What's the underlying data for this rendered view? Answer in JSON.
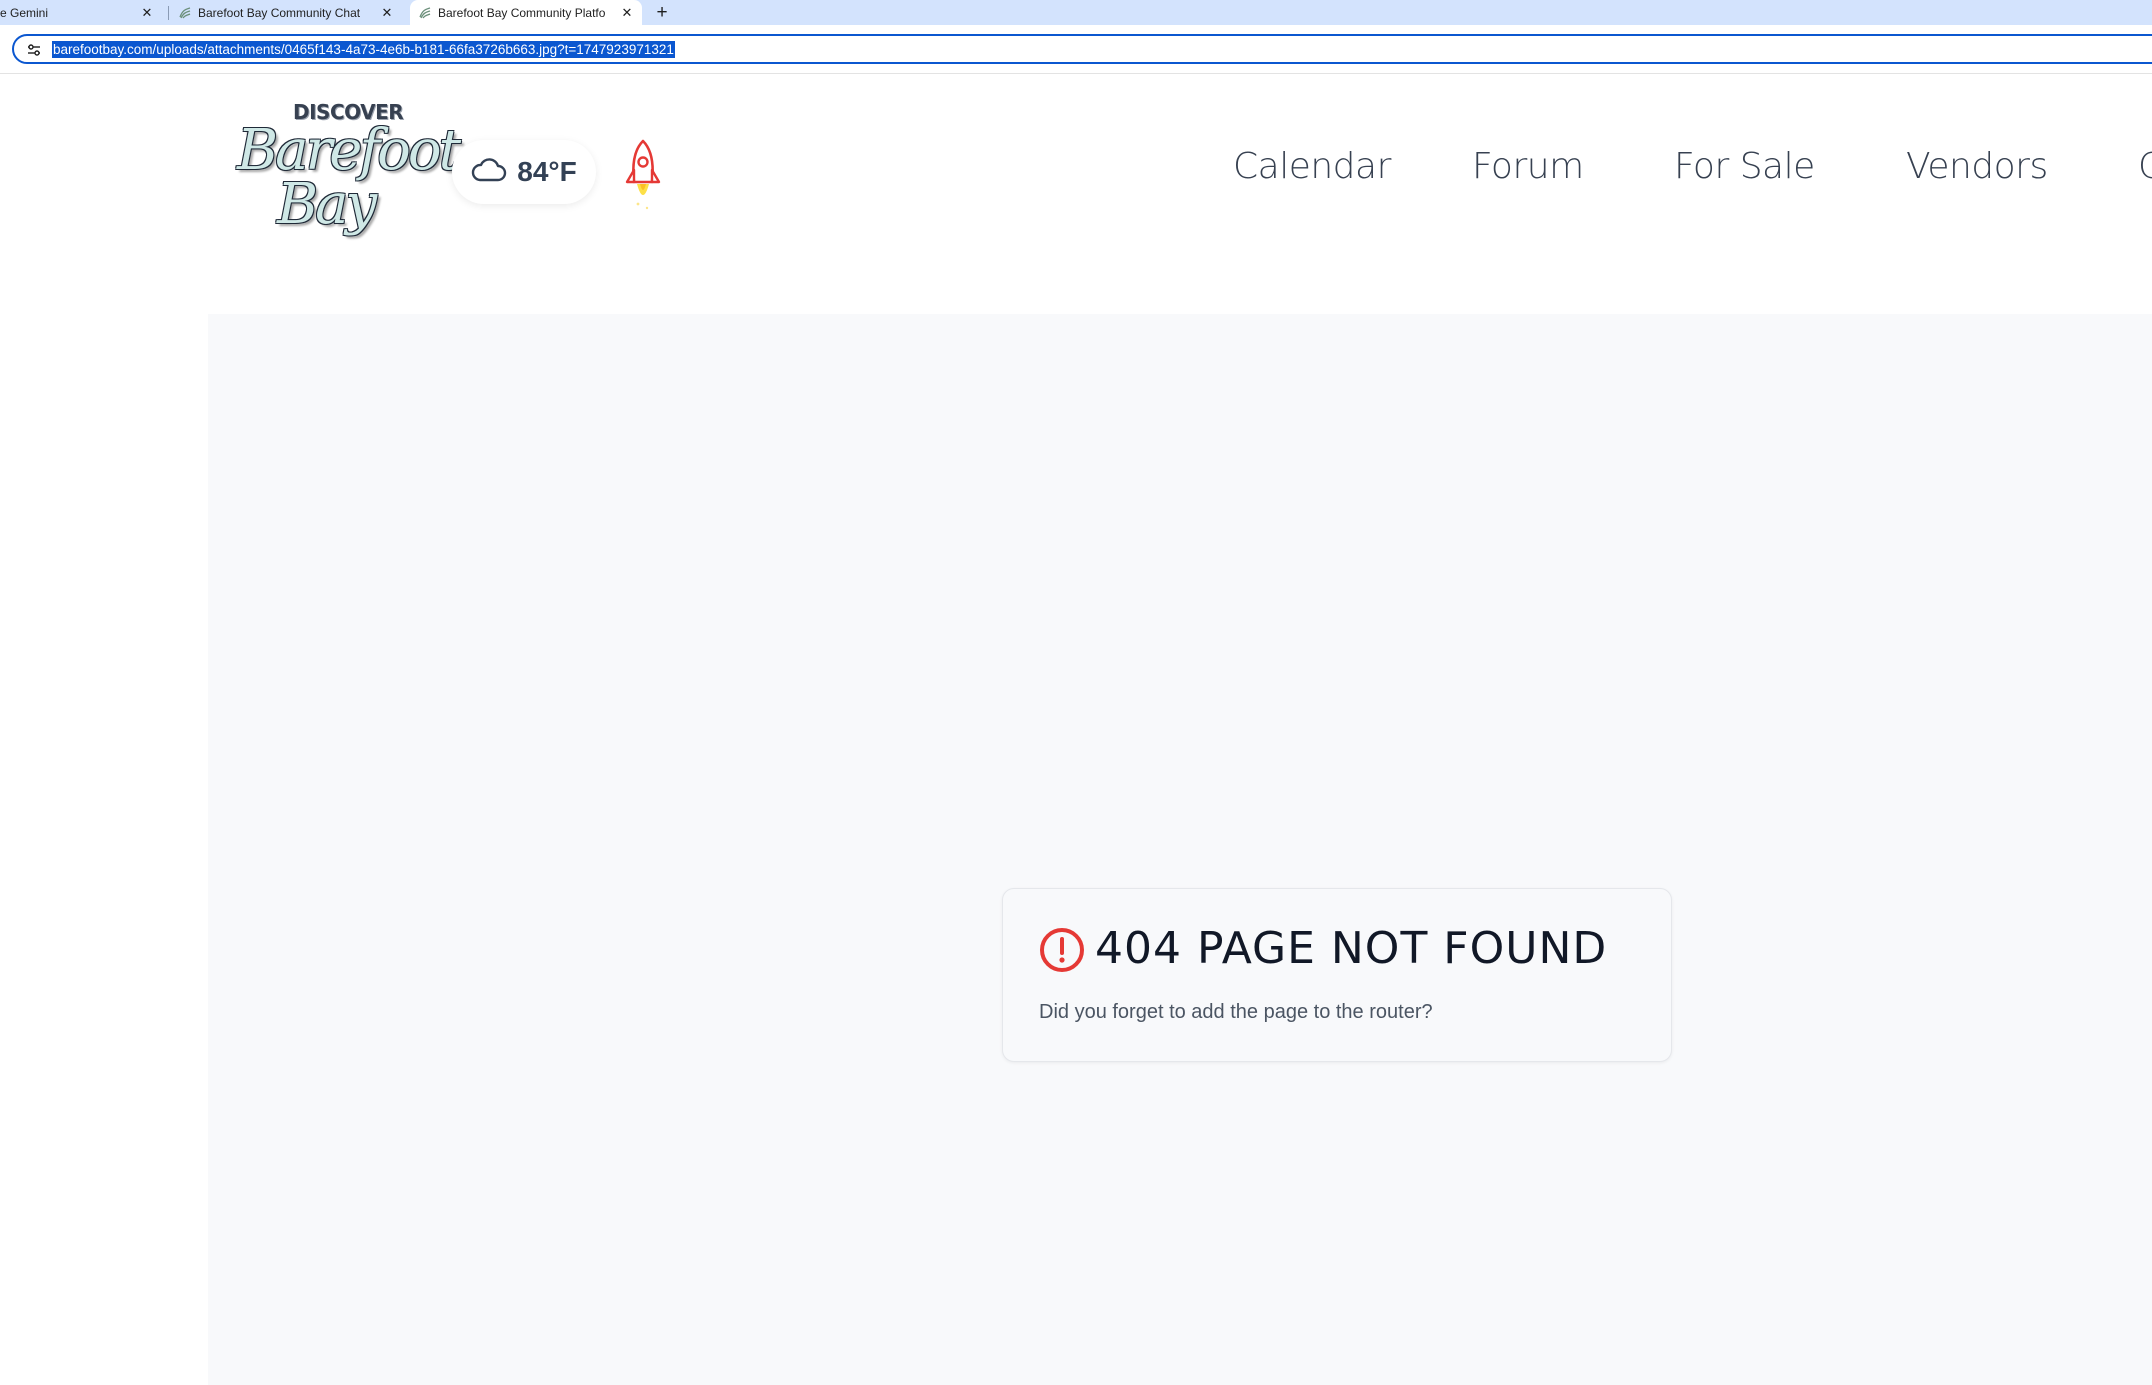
{
  "browser": {
    "tabs": [
      {
        "title": "e Gemini",
        "active": false
      },
      {
        "title": "Barefoot Bay Community Chat",
        "active": false
      },
      {
        "title": "Barefoot Bay Community Platfo",
        "active": true
      }
    ],
    "new_tab_label": "+",
    "close_glyph": "✕",
    "url": "barefootbay.com/uploads/attachments/0465f143-4a73-4e6b-b181-66fa3726b663.jpg?t=1747923971321"
  },
  "header": {
    "logo": {
      "top": "DISCOVER",
      "line1": "Barefoot",
      "line2": "Bay"
    },
    "weather": {
      "icon": "cloud-icon",
      "temperature": "84°F"
    },
    "rocket_icon": "rocket-icon",
    "nav": [
      {
        "label": "Calendar"
      },
      {
        "label": "Forum"
      },
      {
        "label": "For Sale"
      },
      {
        "label": "Vendors"
      },
      {
        "label": "C"
      }
    ]
  },
  "error": {
    "icon": "alert-circle-icon",
    "icon_color": "#e53935",
    "title": "404 PAGE NOT FOUND",
    "message": "Did you forget to add the page to the router?"
  }
}
